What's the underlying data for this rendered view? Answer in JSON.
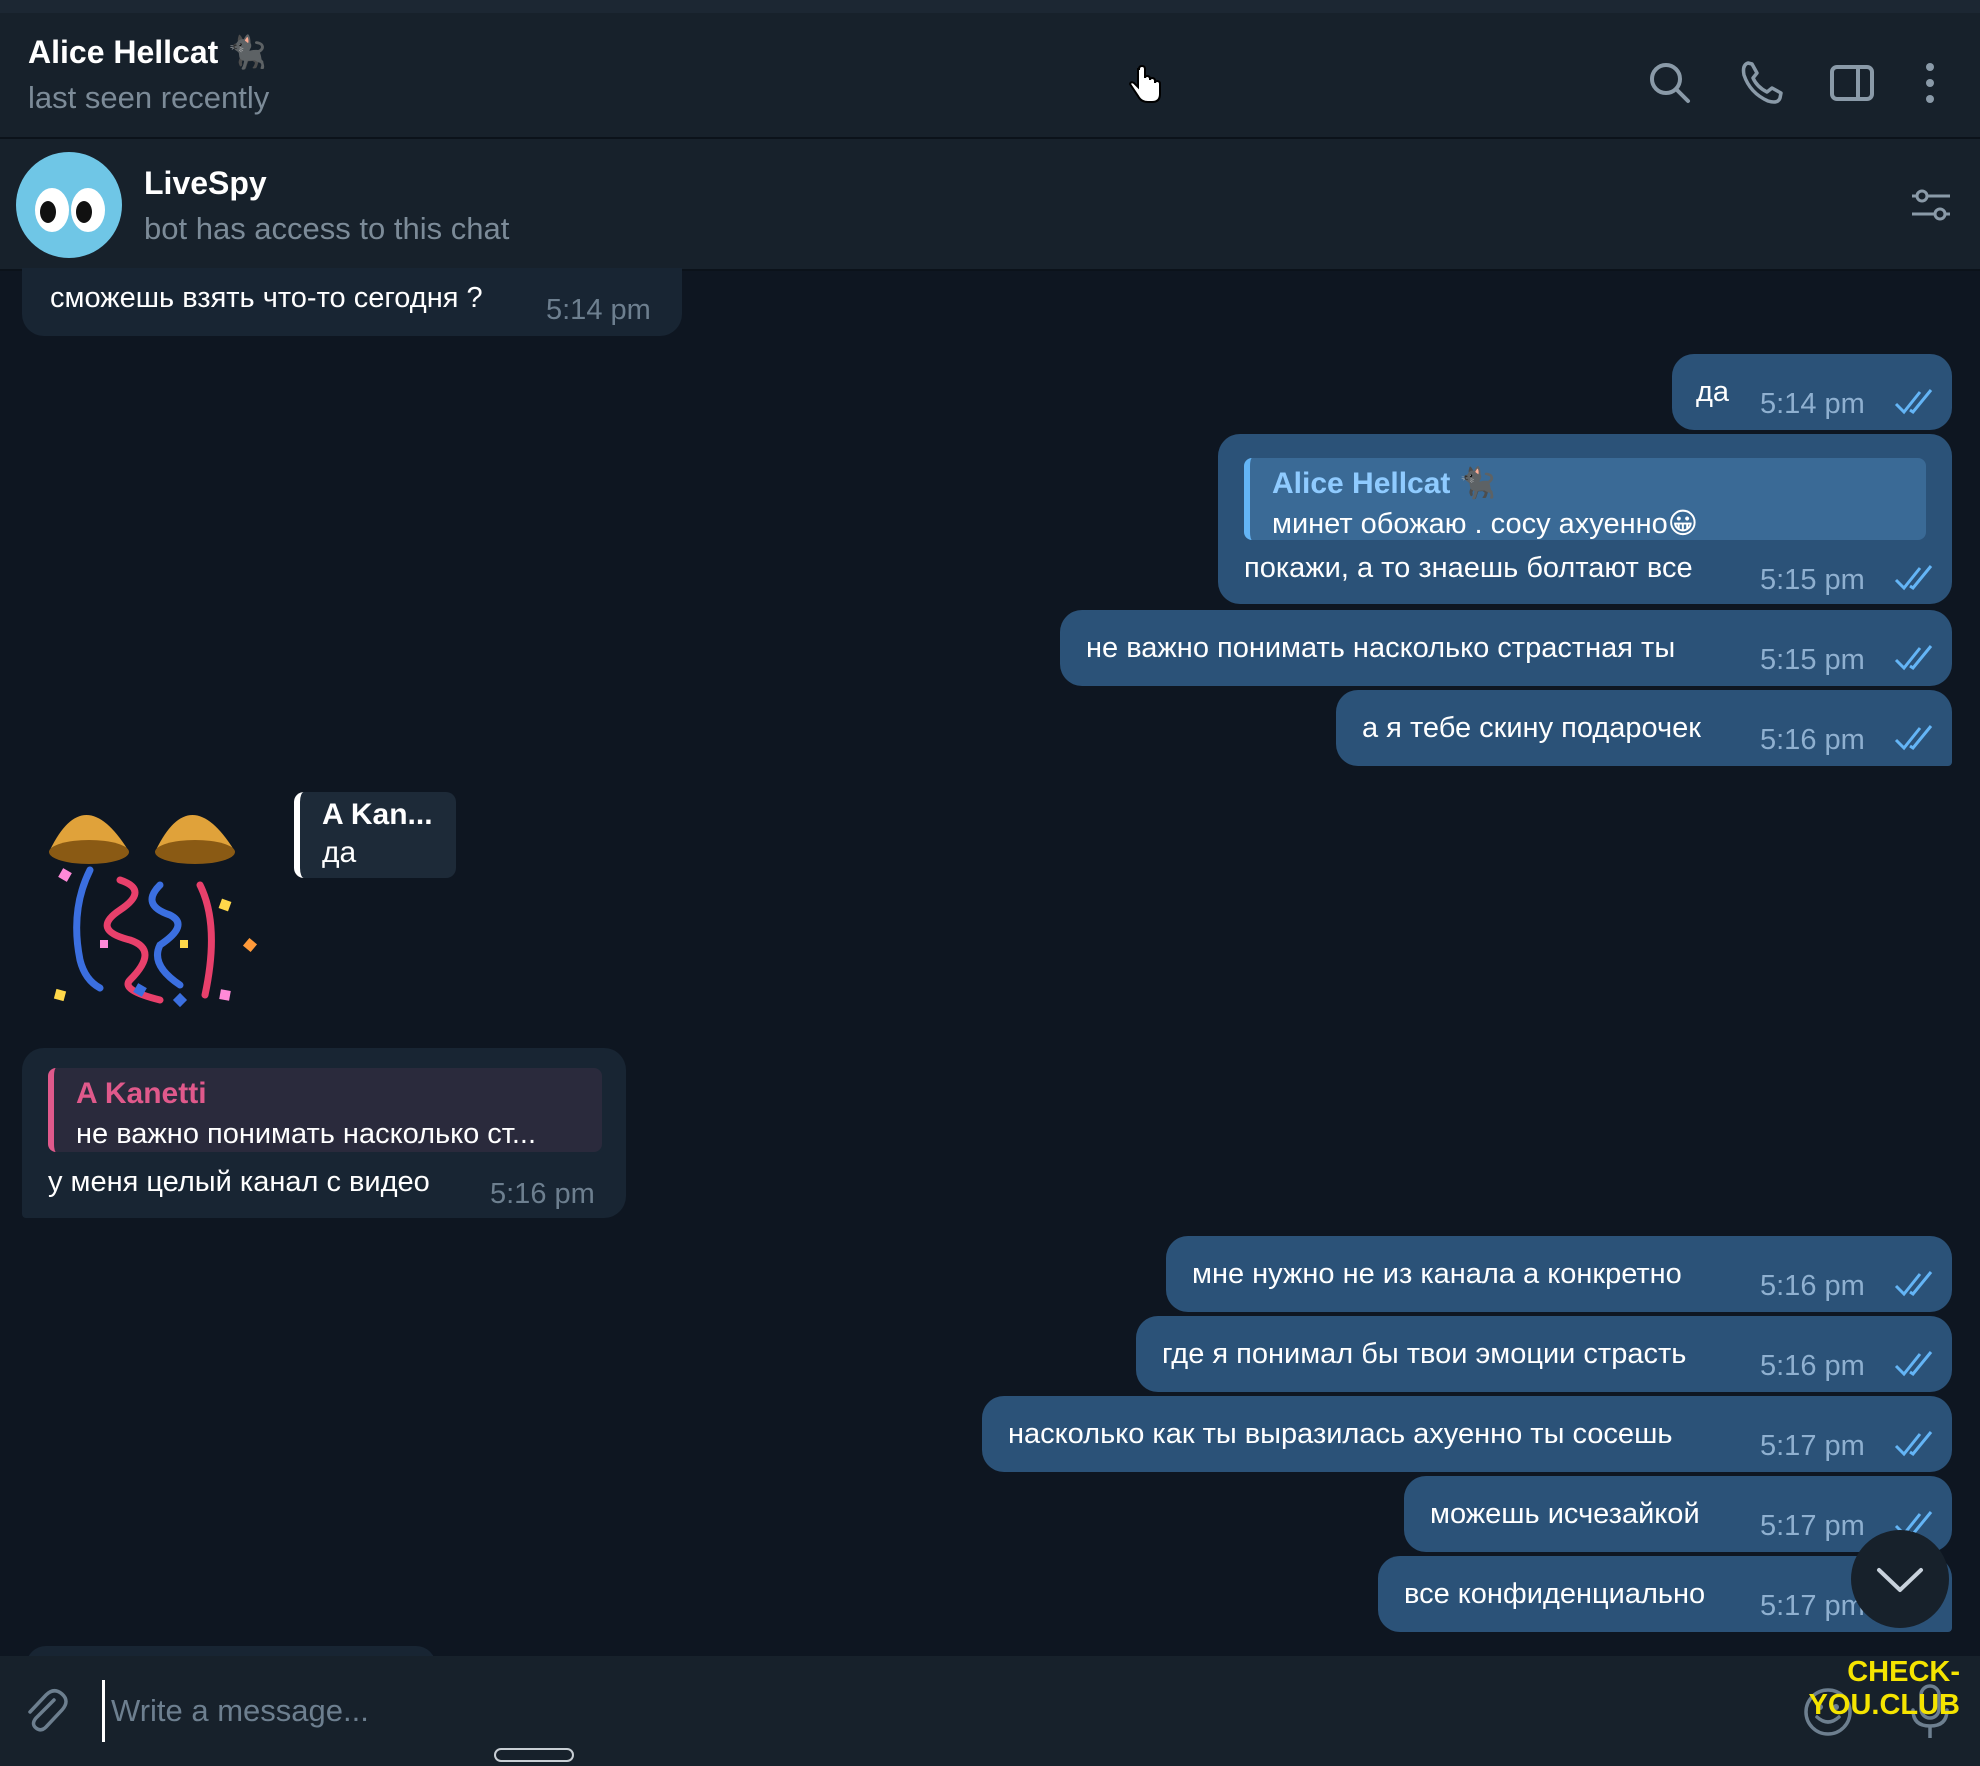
{
  "header": {
    "title": "Alice Hellcat 🐈‍⬛",
    "status": "last seen recently"
  },
  "pinned": {
    "name": "LiveSpy",
    "subtitle": "bot has access to this chat"
  },
  "messages": [
    {
      "text": "сможешь взять что-то сегодня ?",
      "time": "5:14 pm"
    },
    {
      "text": "да",
      "time": "5:14 pm"
    },
    {
      "quote_name": "Alice Hellcat 🐈‍⬛",
      "quote_text": "минет обожаю . сосу ахуенно😀",
      "text": "покажи, а то знаешь болтают все",
      "time": "5:15 pm"
    },
    {
      "text": "не важно понимать насколько страстная ты",
      "time": "5:15 pm"
    },
    {
      "text": "а я тебе скину подарочек",
      "time": "5:16 pm"
    },
    {
      "reply_name": "A Kan...",
      "reply_text": "да"
    },
    {
      "quote_name": "A Kanetti",
      "quote_text": "не важно понимать насколько ст...",
      "text": "у меня целый канал с видео",
      "time": "5:16 pm"
    },
    {
      "text": "мне нужно не из канала а конкретно",
      "time": "5:16 pm"
    },
    {
      "text": "где я понимал бы твои эмоции страсть",
      "time": "5:16 pm"
    },
    {
      "text": "насколько как ты выразилась ахуенно ты сосешь",
      "time": "5:17 pm"
    },
    {
      "text": "можешь исчезайкой",
      "time": "5:17 pm"
    },
    {
      "text": "все конфиденциально",
      "time": "5:17 pm"
    }
  ],
  "input": {
    "placeholder": "Write a message..."
  },
  "watermark": "CHECK-YOU.CLUB",
  "colors": {
    "background": "#0e1621",
    "header": "#17212b",
    "incoming_bubble": "#182533",
    "outgoing_bubble": "#2b5278",
    "accent": "#64b5f6",
    "quote_pink": "#e0598b",
    "watermark": "#f5e400"
  },
  "icons": [
    "search-icon",
    "phone-icon",
    "sidebar-toggle-icon",
    "more-icon",
    "filter-icon",
    "paperclip-icon",
    "emoji-icon",
    "mic-icon",
    "chevron-down-icon",
    "double-check-icon"
  ]
}
